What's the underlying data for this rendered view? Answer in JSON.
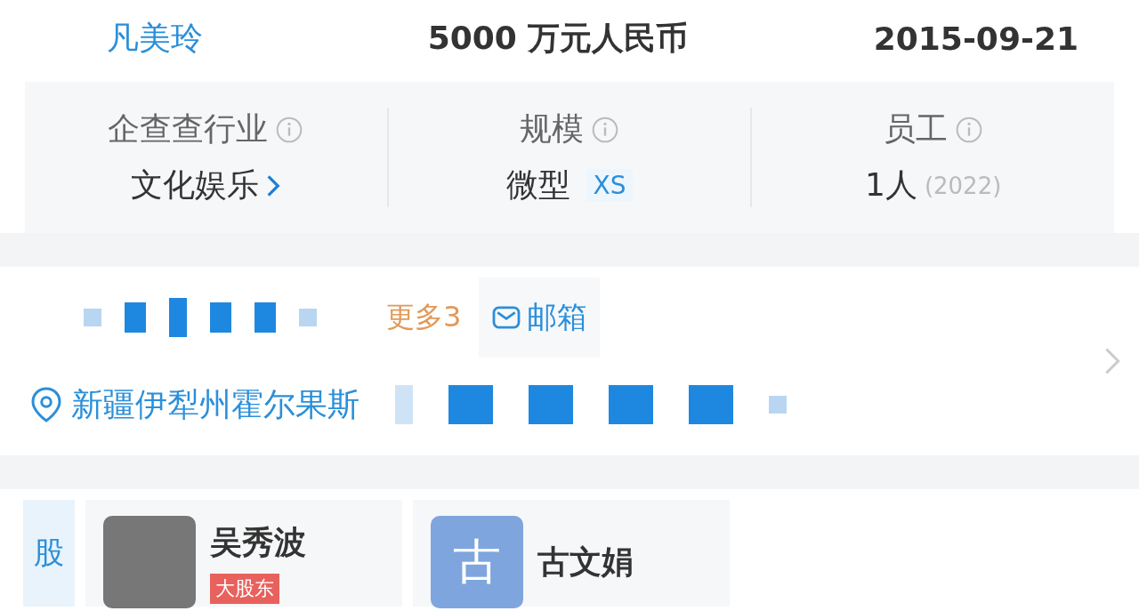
{
  "basics": [
    {
      "value": "凡美玲",
      "kind": "link"
    },
    {
      "value": "5000 万元人民币",
      "kind": "plain"
    },
    {
      "value": "2015-09-21",
      "kind": "plain"
    }
  ],
  "stats": [
    {
      "label": "企查查行业",
      "value": "文化娱乐",
      "kind": "link"
    },
    {
      "label": "规模",
      "value": "微型",
      "tag": "XS",
      "kind": "tag"
    },
    {
      "label": "员工",
      "value": "1人",
      "note": "(2022)",
      "kind": "note"
    }
  ],
  "contact": {
    "more": "更多3",
    "email": "邮箱",
    "address": "新疆伊犁州霍尔果斯"
  },
  "shareholders": {
    "label": "股",
    "items": [
      {
        "name": "吴秀波",
        "badge": "大股东",
        "kind": "photo"
      },
      {
        "name": "古文娟",
        "initial": "古",
        "kind": "initial"
      }
    ]
  }
}
